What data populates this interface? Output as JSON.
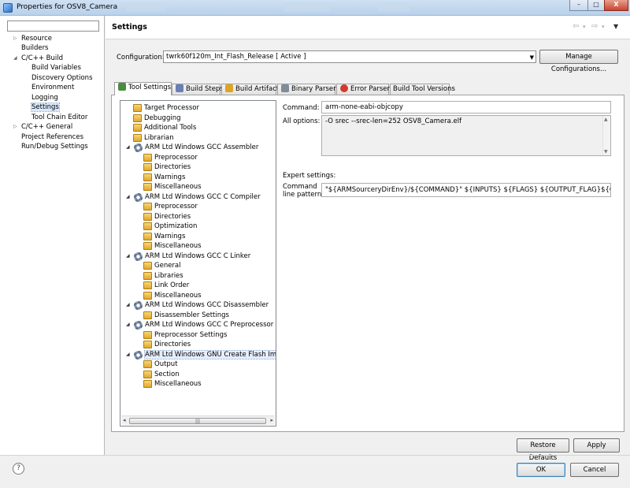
{
  "window": {
    "title": "Properties for OSV8_Camera",
    "controls": {
      "minimize": "–",
      "maximize": "□",
      "close": "X"
    }
  },
  "left_nav": {
    "filter_placeholder": "",
    "items": [
      {
        "label": "Resource",
        "expandable": true
      },
      {
        "label": "Builders"
      },
      {
        "label": "C/C++ Build",
        "expanded": true
      },
      {
        "label": "Build Variables"
      },
      {
        "label": "Discovery Options"
      },
      {
        "label": "Environment"
      },
      {
        "label": "Logging"
      },
      {
        "label": "Settings",
        "selected": true
      },
      {
        "label": "Tool Chain Editor"
      },
      {
        "label": "C/C++ General",
        "expandable": true
      },
      {
        "label": "Project References"
      },
      {
        "label": "Run/Debug Settings"
      }
    ]
  },
  "header": {
    "title": "Settings",
    "back_icon": "back-arrow-icon",
    "forward_icon": "forward-arrow-icon",
    "menu_icon": "chevron-down-icon"
  },
  "configuration": {
    "label": "Configuration:",
    "value": "twrk60f120m_Int_Flash_Release  [ Active ]",
    "manage_button": "Manage Configurations..."
  },
  "tabs": [
    {
      "label": "Tool Settings",
      "active": true,
      "icon": "tool-settings-icon",
      "color": "#4a8c3f"
    },
    {
      "label": "Build Steps",
      "icon": "build-steps-icon",
      "color": "#6a7fb5"
    },
    {
      "label": "Build Artifact",
      "icon": "build-artifact-icon",
      "color": "#e0a520"
    },
    {
      "label": "Binary Parsers",
      "icon": "binary-parsers-icon",
      "color": "#7f8c99"
    },
    {
      "label": "Error Parsers",
      "icon": "error-parsers-icon",
      "color": "#d23a2a"
    },
    {
      "label": "Build Tool Versions",
      "icon": "",
      "color": ""
    }
  ],
  "tool_tree": [
    {
      "label": "Target Processor",
      "level": 1,
      "type": "option"
    },
    {
      "label": "Debugging",
      "level": 1,
      "type": "option"
    },
    {
      "label": "Additional Tools",
      "level": 1,
      "type": "option"
    },
    {
      "label": "Librarian",
      "level": 1,
      "type": "option"
    },
    {
      "label": "ARM Ltd Windows GCC Assembler",
      "level": 0,
      "type": "tool"
    },
    {
      "label": "Preprocessor",
      "level": 2,
      "type": "option"
    },
    {
      "label": "Directories",
      "level": 2,
      "type": "option"
    },
    {
      "label": "Warnings",
      "level": 2,
      "type": "option"
    },
    {
      "label": "Miscellaneous",
      "level": 2,
      "type": "option"
    },
    {
      "label": "ARM Ltd Windows GCC C Compiler",
      "level": 0,
      "type": "tool"
    },
    {
      "label": "Preprocessor",
      "level": 2,
      "type": "option"
    },
    {
      "label": "Directories",
      "level": 2,
      "type": "option"
    },
    {
      "label": "Optimization",
      "level": 2,
      "type": "option"
    },
    {
      "label": "Warnings",
      "level": 2,
      "type": "option"
    },
    {
      "label": "Miscellaneous",
      "level": 2,
      "type": "option"
    },
    {
      "label": "ARM Ltd Windows GCC C Linker",
      "level": 0,
      "type": "tool"
    },
    {
      "label": "General",
      "level": 2,
      "type": "option"
    },
    {
      "label": "Libraries",
      "level": 2,
      "type": "option"
    },
    {
      "label": "Link Order",
      "level": 2,
      "type": "option"
    },
    {
      "label": "Miscellaneous",
      "level": 2,
      "type": "option"
    },
    {
      "label": "ARM Ltd Windows GCC Disassembler",
      "level": 0,
      "type": "tool"
    },
    {
      "label": "Disassembler Settings",
      "level": 2,
      "type": "option"
    },
    {
      "label": "ARM Ltd Windows GCC C Preprocessor",
      "level": 0,
      "type": "tool"
    },
    {
      "label": "Preprocessor Settings",
      "level": 2,
      "type": "option"
    },
    {
      "label": "Directories",
      "level": 2,
      "type": "option"
    },
    {
      "label": "ARM Ltd Windows GNU Create Flash Image",
      "level": 0,
      "type": "tool",
      "selected": true
    },
    {
      "label": "Output",
      "level": 2,
      "type": "option"
    },
    {
      "label": "Section",
      "level": 2,
      "type": "option"
    },
    {
      "label": "Miscellaneous",
      "level": 2,
      "type": "option"
    }
  ],
  "detail": {
    "command_label": "Command:",
    "command_value": "arm-none-eabi-objcopy",
    "all_options_label": "All options:",
    "all_options_value": "-O srec --srec-len=252 OSV8_Camera.elf",
    "expert_label": "Expert settings:",
    "pattern_label_1": "Command",
    "pattern_label_2": "line pattern:",
    "pattern_value": "\"${ARMSourceryDirEnv}/${COMMAND}\" ${INPUTS} ${FLAGS} ${OUTPUT_FLAG}${OUTPUT_PREFIX} ${O"
  },
  "buttons": {
    "restore_defaults": "Restore Defaults",
    "apply": "Apply",
    "ok": "OK",
    "cancel": "Cancel"
  },
  "help_icon": "?"
}
